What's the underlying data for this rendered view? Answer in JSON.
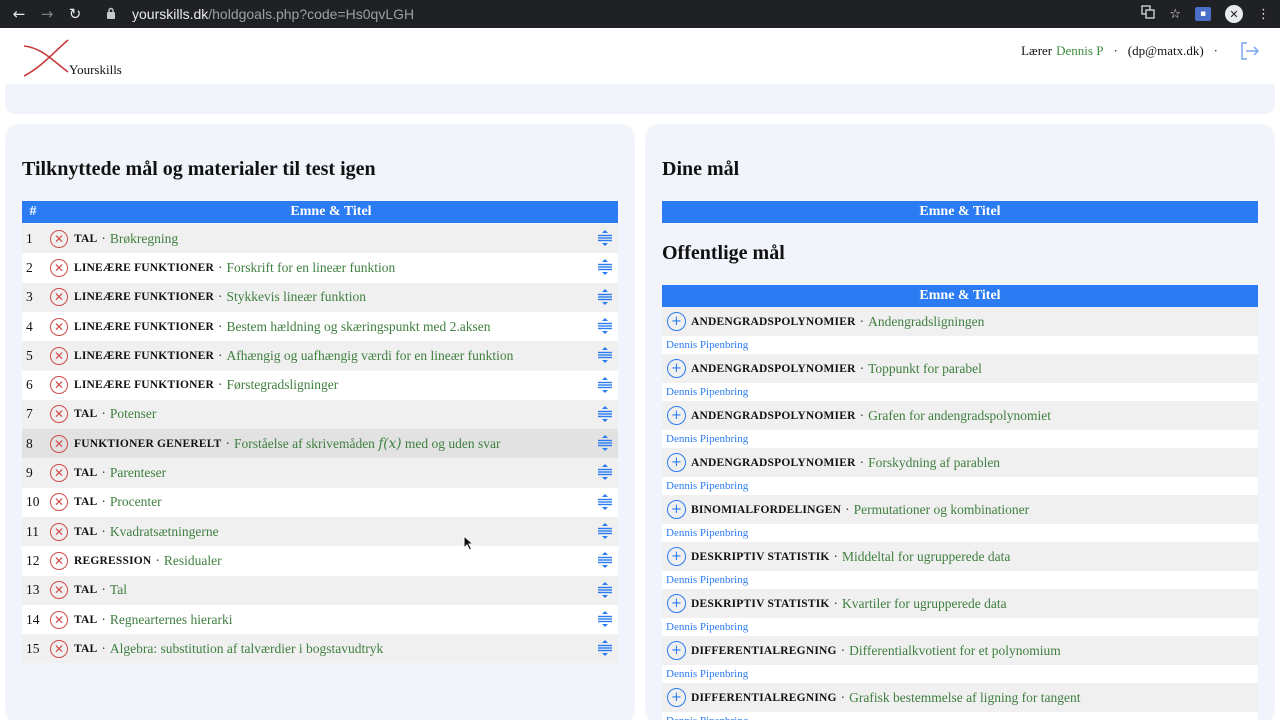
{
  "browser": {
    "url_host": "yourskills.dk",
    "url_path": "/holdgoals.php?code=Hs0qvLGH"
  },
  "header": {
    "logo_text": "Yourskills",
    "role": "Lærer",
    "user_name": "Dennis P",
    "separator": "·",
    "email": "(dp@matx.dk)"
  },
  "left_panel": {
    "title": "Tilknyttede mål og materialer til test igen",
    "col_hash": "#",
    "col_title": "Emne & Titel",
    "dot": "·",
    "rows": [
      {
        "num": "1",
        "topic": "TAL",
        "title": "Brøkregning"
      },
      {
        "num": "2",
        "topic": "LINEÆRE FUNKTIONER",
        "title": "Forskrift for en lineær funktion"
      },
      {
        "num": "3",
        "topic": "LINEÆRE FUNKTIONER",
        "title": "Stykkevis lineær funktion"
      },
      {
        "num": "4",
        "topic": "LINEÆRE FUNKTIONER",
        "title": "Bestem hældning og skæringspunkt med 2.aksen"
      },
      {
        "num": "5",
        "topic": "LINEÆRE FUNKTIONER",
        "title": "Afhængig og uafhængig værdi for en lineær funktion"
      },
      {
        "num": "6",
        "topic": "LINEÆRE FUNKTIONER",
        "title": "Førstegradsligninger"
      },
      {
        "num": "7",
        "topic": "TAL",
        "title": "Potenser"
      },
      {
        "num": "8",
        "topic": "FUNKTIONER GENERELT",
        "title_a": "Forståelse af skrivemåden",
        "math": "f(x)",
        "title_b": "med og uden svar"
      },
      {
        "num": "9",
        "topic": "TAL",
        "title": "Parenteser"
      },
      {
        "num": "10",
        "topic": "TAL",
        "title": "Procenter"
      },
      {
        "num": "11",
        "topic": "TAL",
        "title": "Kvadratsætningerne"
      },
      {
        "num": "12",
        "topic": "REGRESSION",
        "title": "Residualer"
      },
      {
        "num": "13",
        "topic": "TAL",
        "title": "Tal"
      },
      {
        "num": "14",
        "topic": "TAL",
        "title": "Regnearternes hierarki"
      },
      {
        "num": "15",
        "topic": "TAL",
        "title": "Algebra: substitution af talværdier i bogstavudtryk"
      }
    ]
  },
  "right_panel": {
    "my_goals_title": "Dine mål",
    "col_title": "Emne & Titel",
    "public_title": "Offentlige mål",
    "dot": "·",
    "public_rows": [
      {
        "topic": "ANDENGRADSPOLYNOMIER",
        "title": "Andengradsligningen",
        "author": "Dennis Pipenbring"
      },
      {
        "topic": "ANDENGRADSPOLYNOMIER",
        "title": "Toppunkt for parabel",
        "author": "Dennis Pipenbring"
      },
      {
        "topic": "ANDENGRADSPOLYNOMIER",
        "title": "Grafen for andengradspolynomiet",
        "author": "Dennis Pipenbring"
      },
      {
        "topic": "ANDENGRADSPOLYNOMIER",
        "title": "Forskydning af parablen",
        "author": "Dennis Pipenbring"
      },
      {
        "topic": "BINOMIALFORDELINGEN",
        "title": "Permutationer og kombinationer",
        "author": "Dennis Pipenbring"
      },
      {
        "topic": "DESKRIPTIV STATISTIK",
        "title": "Middeltal for ugrupperede data",
        "author": "Dennis Pipenbring"
      },
      {
        "topic": "DESKRIPTIV STATISTIK",
        "title": "Kvartiler for ugrupperede data",
        "author": "Dennis Pipenbring"
      },
      {
        "topic": "DIFFERENTIALREGNING",
        "title": "Differentialkvotient for et polynomium",
        "author": "Dennis Pipenbring"
      },
      {
        "topic": "DIFFERENTIALREGNING",
        "title": "Grafisk bestemmelse af ligning for tangent",
        "author": "Dennis Pipenbring"
      }
    ]
  },
  "icons": {
    "back": "←",
    "forward": "→",
    "reload": "↻",
    "lock": "🔒",
    "star": "☆",
    "menu": "⋮",
    "remove": "✕",
    "add": "+"
  },
  "colors": {
    "accent_blue": "#2b7bf3",
    "title_green": "#3f7f3f",
    "remove_red": "#d14b4b",
    "panel_bg": "#f1f5fb"
  }
}
